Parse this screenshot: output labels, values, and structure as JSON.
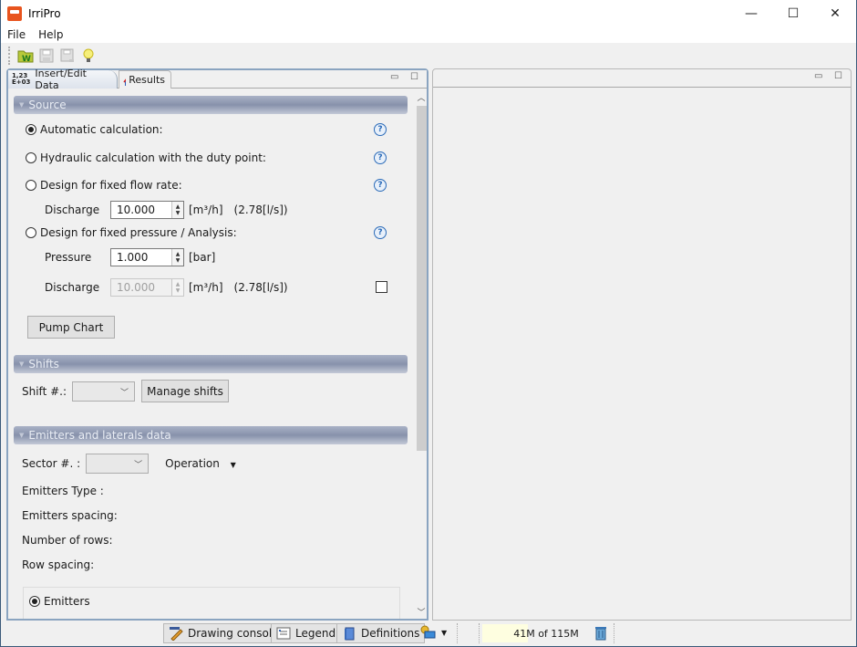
{
  "window": {
    "title": "IrriPro",
    "controls": {
      "minimize": "—",
      "maximize": "☐",
      "close": "✕"
    }
  },
  "menu": {
    "items": [
      "File",
      "Help"
    ]
  },
  "toolbar": {
    "buttons": [
      {
        "name": "open-project",
        "icon": "folder-w-icon"
      },
      {
        "name": "save",
        "icon": "floppy-icon",
        "disabled": true
      },
      {
        "name": "save-as",
        "icon": "floppy-as-icon",
        "disabled": true
      },
      {
        "name": "tips",
        "icon": "lightbulb-icon"
      }
    ]
  },
  "left_panel": {
    "tabs": [
      {
        "label": "Insert/Edit Data",
        "icon_top": "1,23",
        "icon_bottom": "E+03",
        "active": true
      },
      {
        "label": "Results",
        "active": false
      }
    ],
    "source": {
      "header": "Source",
      "options": [
        {
          "label": "Automatic calculation:",
          "checked": true
        },
        {
          "label": "Hydraulic calculation with the duty point:",
          "checked": false
        },
        {
          "label": "Design for fixed flow rate:",
          "checked": false
        },
        {
          "label": "Design for fixed pressure / Analysis:",
          "checked": false
        }
      ],
      "flow_discharge": {
        "label": "Discharge",
        "value": "10.000",
        "unit": "[m³/h]",
        "converted": "(2.78[l/s])"
      },
      "pressure": {
        "label": "Pressure",
        "value": "1.000",
        "unit": "[bar]"
      },
      "pressure_discharge": {
        "label": "Discharge",
        "value": "10.000",
        "unit": "[m³/h]",
        "converted": "(2.78[l/s])",
        "disabled": true,
        "checkbox_checked": false
      },
      "pump_chart_button": "Pump Chart",
      "help_symbol": "?"
    },
    "shifts": {
      "header": "Shifts",
      "shift_label": "Shift #.:",
      "shift_value": "",
      "manage_button": "Manage shifts"
    },
    "emitters": {
      "header": "Emitters and laterals data",
      "sector_label": "Sector #. :",
      "sector_value": "",
      "operation_label": "Operation",
      "fields": [
        "Emitters Type :",
        "Emitters spacing:",
        "Number of rows:",
        "Row spacing:"
      ],
      "emitters_option": {
        "label": "Emitters",
        "checked": true
      }
    },
    "panel_controls": {
      "minimize": "▭",
      "maximize": "☐"
    }
  },
  "right_panel": {
    "panel_controls": {
      "minimize": "▭",
      "maximize": "☐"
    }
  },
  "statusbar": {
    "buttons": [
      "Drawing console",
      "Legend",
      "Definitions"
    ],
    "memory": {
      "text": "41M of 115M",
      "used_fraction": 0.36
    }
  }
}
